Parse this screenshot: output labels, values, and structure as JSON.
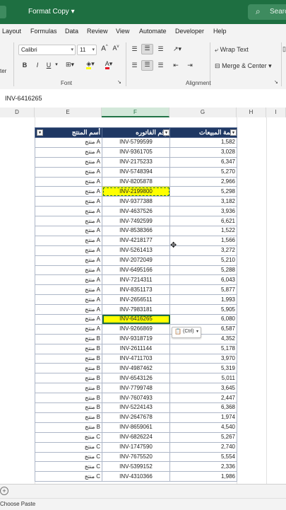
{
  "titlebar": {
    "macro_name": "Format Copy",
    "search_label": "Search"
  },
  "ribbon_tabs": [
    "Layout",
    "Formulas",
    "Data",
    "Review",
    "View",
    "Automate",
    "Developer",
    "Help"
  ],
  "font": {
    "name": "Calibri",
    "size": "11",
    "group_label": "Font"
  },
  "alignment": {
    "wrap_text_label": "Wrap Text",
    "merge_label": "Merge & Center",
    "group_label": "Alignment"
  },
  "clipboard": {
    "partial_label": "ter"
  },
  "name_box": "INV-6416265",
  "columns": [
    "D",
    "E",
    "F",
    "G",
    "H",
    "I"
  ],
  "table": {
    "headers": {
      "product": "أسم المنتج",
      "invoice": "رقم الفاتوره",
      "sales": "قيمة المبيعات"
    },
    "rows": [
      {
        "product": "منتج A",
        "invoice": "INV-5799599",
        "sales": "1,582"
      },
      {
        "product": "منتج A",
        "invoice": "INV-9361705",
        "sales": "3,028"
      },
      {
        "product": "منتج A",
        "invoice": "INV-2175233",
        "sales": "6,347"
      },
      {
        "product": "منتج A",
        "invoice": "INV-5748394",
        "sales": "5,270"
      },
      {
        "product": "منتج A",
        "invoice": "INV-8205878",
        "sales": "2,966"
      },
      {
        "product": "منتج A",
        "invoice": "INV-2199800",
        "sales": "5,298"
      },
      {
        "product": "منتج A",
        "invoice": "INV-9377388",
        "sales": "3,182"
      },
      {
        "product": "منتج A",
        "invoice": "INV-4637526",
        "sales": "3,936"
      },
      {
        "product": "منتج A",
        "invoice": "INV-7492599",
        "sales": "6,621"
      },
      {
        "product": "منتج A",
        "invoice": "INV-8538366",
        "sales": "1,522"
      },
      {
        "product": "منتج A",
        "invoice": "INV-4218177",
        "sales": "1,566"
      },
      {
        "product": "منتج A",
        "invoice": "INV-5261413",
        "sales": "3,272"
      },
      {
        "product": "منتج A",
        "invoice": "INV-2072049",
        "sales": "5,210"
      },
      {
        "product": "منتج A",
        "invoice": "INV-6495166",
        "sales": "5,288"
      },
      {
        "product": "منتج A",
        "invoice": "INV-7214311",
        "sales": "6,043"
      },
      {
        "product": "منتج A",
        "invoice": "INV-8351173",
        "sales": "5,877"
      },
      {
        "product": "منتج A",
        "invoice": "INV-2656511",
        "sales": "1,993"
      },
      {
        "product": "منتج A",
        "invoice": "INV-7983181",
        "sales": "5,905"
      },
      {
        "product": "منتج A",
        "invoice": "INV-6416265",
        "sales": "6,080"
      },
      {
        "product": "منتج A",
        "invoice": "INV-9266869",
        "sales": "6,587"
      },
      {
        "product": "منتج B",
        "invoice": "INV-9318719",
        "sales": "4,352"
      },
      {
        "product": "منتج B",
        "invoice": "INV-2611144",
        "sales": "5,178"
      },
      {
        "product": "منتج B",
        "invoice": "INV-4711703",
        "sales": "3,970"
      },
      {
        "product": "منتج B",
        "invoice": "INV-4987462",
        "sales": "5,319"
      },
      {
        "product": "منتج B",
        "invoice": "INV-6543126",
        "sales": "5,011"
      },
      {
        "product": "منتج B",
        "invoice": "INV-7799748",
        "sales": "3,645"
      },
      {
        "product": "منتج B",
        "invoice": "INV-7607493",
        "sales": "2,447"
      },
      {
        "product": "منتج B",
        "invoice": "INV-5224143",
        "sales": "6,368"
      },
      {
        "product": "منتج B",
        "invoice": "INV-2647678",
        "sales": "1,974"
      },
      {
        "product": "منتج B",
        "invoice": "INV-8659061",
        "sales": "4,540"
      },
      {
        "product": "منتج C",
        "invoice": "INV-6826224",
        "sales": "5,267"
      },
      {
        "product": "منتج C",
        "invoice": "INV-1747590",
        "sales": "2,740"
      },
      {
        "product": "منتج C",
        "invoice": "INV-7675520",
        "sales": "5,554"
      },
      {
        "product": "منتج C",
        "invoice": "INV-5399152",
        "sales": "2,336"
      },
      {
        "product": "منتج C",
        "invoice": "INV-4310366",
        "sales": "1,986"
      }
    ]
  },
  "paste_options_label": "(Ctrl)",
  "status_text": "Choose Paste",
  "colors": {
    "header_fill": "#1f3864",
    "highlight": "#ffff00",
    "accent": "#217346"
  }
}
